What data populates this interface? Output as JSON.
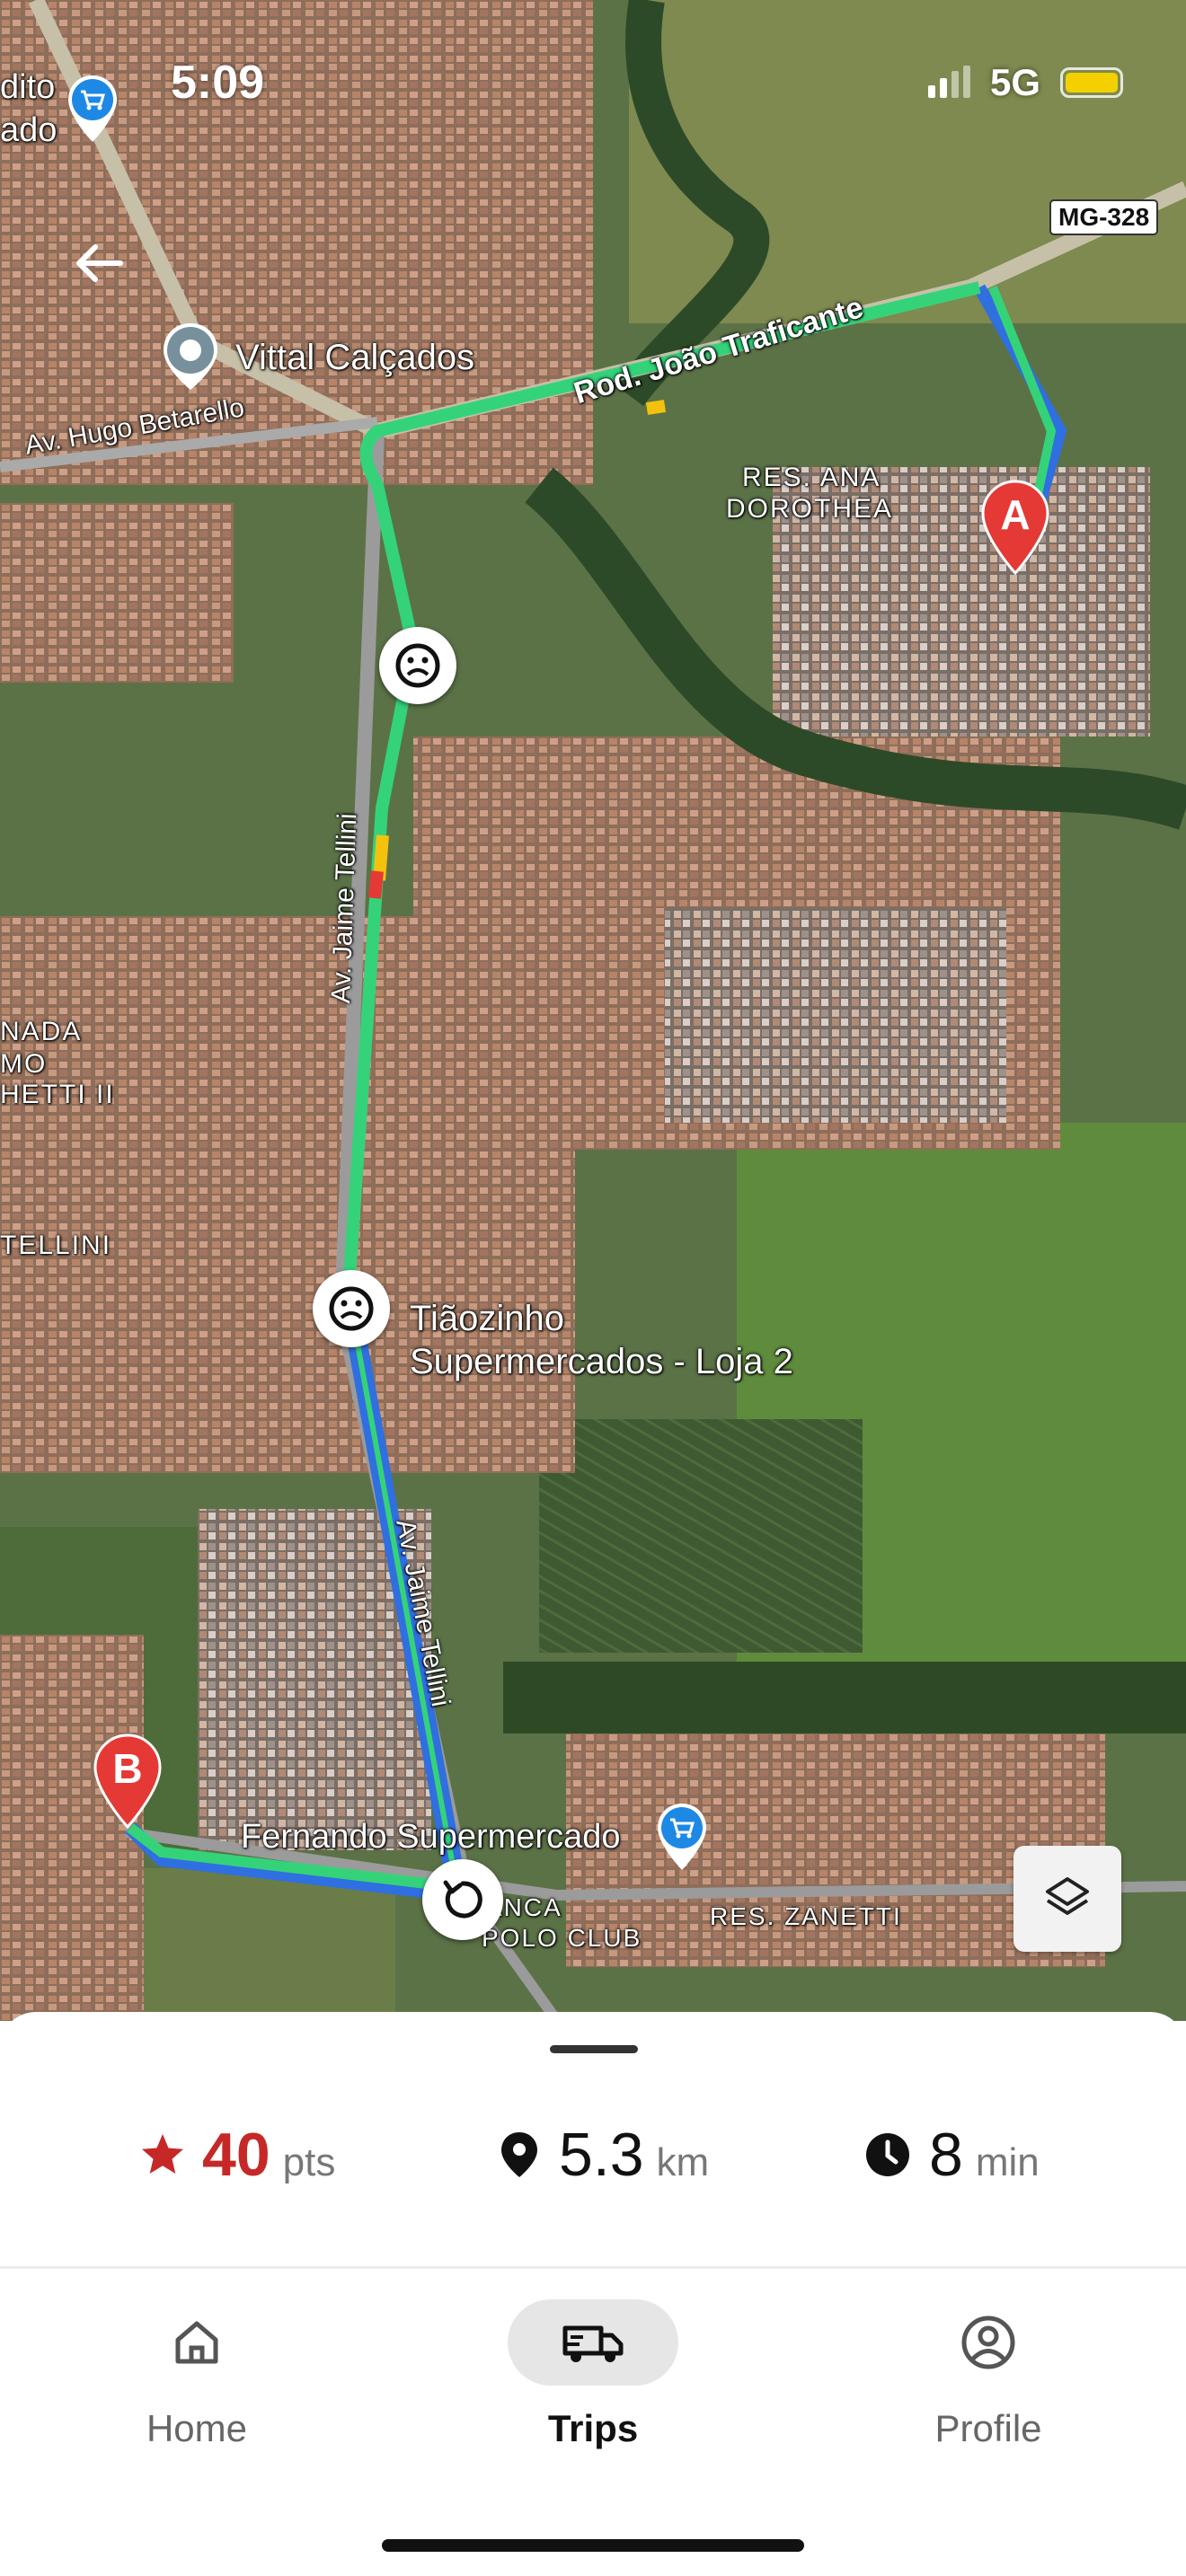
{
  "status_bar": {
    "time": "5:09",
    "network": "5G"
  },
  "map": {
    "labels": {
      "store_partial_top": "dito",
      "store_partial_bottom": "ado",
      "vittal": "Vittal Calçados",
      "av_hugo": "Av. Hugo Betarello",
      "rod_joao": "Rod. João Traficante",
      "res_ana_1": "RES. ANA",
      "res_ana_2": "DOROTHEA",
      "mg328": "MG-328",
      "av_jaime_1": "Av. Jaime Tellini",
      "av_jaime_2": "Av. Jaime Tellini",
      "nada_1": "NADA",
      "nada_2": "MO",
      "nada_3": "HETTI II",
      "tellini": "TELLINI",
      "tiaozinho_1": "Tiãozinho",
      "tiaozinho_2": "Supermercados - Loja 2",
      "fernando": "Fernando Supermercado",
      "polo_1": "ANCA",
      "polo_2": "POLO CLUB",
      "res_zanetti": "RES. ZANETTI"
    },
    "marker_a": "A",
    "marker_b": "B",
    "icons": [
      "back-arrow-icon",
      "layers-icon",
      "sad-face-icon",
      "replay-icon",
      "shopping-cart-icon",
      "location-pin-icon"
    ],
    "route_colors": {
      "green": "#34d37a",
      "blue": "#2f6fe0",
      "yellow": "#f4c20d",
      "red": "#e53935"
    }
  },
  "stats": {
    "points_value": "40",
    "points_unit": "pts",
    "distance_value": "5.3",
    "distance_unit": "km",
    "time_value": "8",
    "time_unit": "min"
  },
  "bottom_nav": {
    "items": [
      {
        "label": "Home",
        "icon": "home-icon",
        "active": false
      },
      {
        "label": "Trips",
        "icon": "truck-icon",
        "active": true
      },
      {
        "label": "Profile",
        "icon": "profile-icon",
        "active": false
      }
    ]
  },
  "colors": {
    "accent_red": "#c62828",
    "text_dark": "#111111",
    "text_gray": "#777777"
  }
}
